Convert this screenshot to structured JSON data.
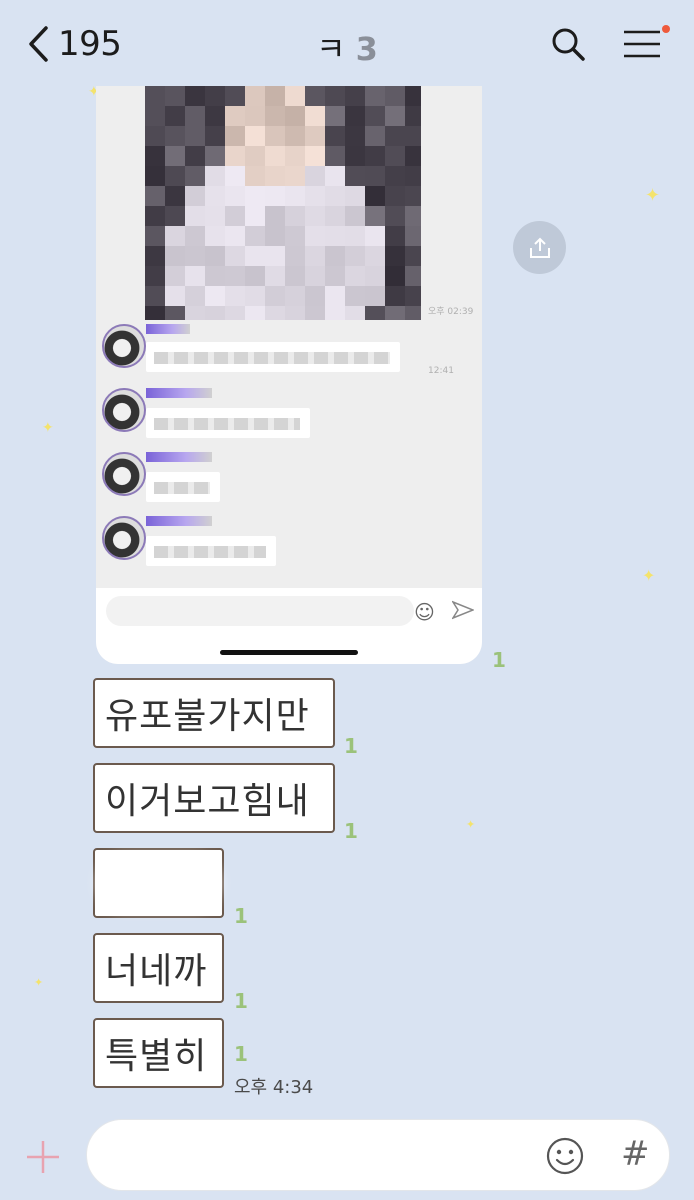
{
  "header": {
    "unread_count": "195",
    "title": "ㅋ",
    "member_count": "3"
  },
  "embedded": {
    "photo_time": "오후 02:39",
    "msg_time": "12:41"
  },
  "messages": [
    {
      "text": "유포불가지만",
      "read": "1"
    },
    {
      "text": "이거보고힘내",
      "read": "1"
    },
    {
      "text": "",
      "read": "1"
    },
    {
      "text": "너네까",
      "read": "1"
    },
    {
      "text": "특별히",
      "read": "1"
    }
  ],
  "image_read": "1",
  "last_time": "오후 4:34",
  "composer": {
    "hash": "#"
  },
  "colors": {
    "background": "#d9e3f2",
    "read_indicator": "#9bc27a",
    "bubble_border": "#6b5a4e",
    "notification_dot": "#ee5a3c"
  }
}
